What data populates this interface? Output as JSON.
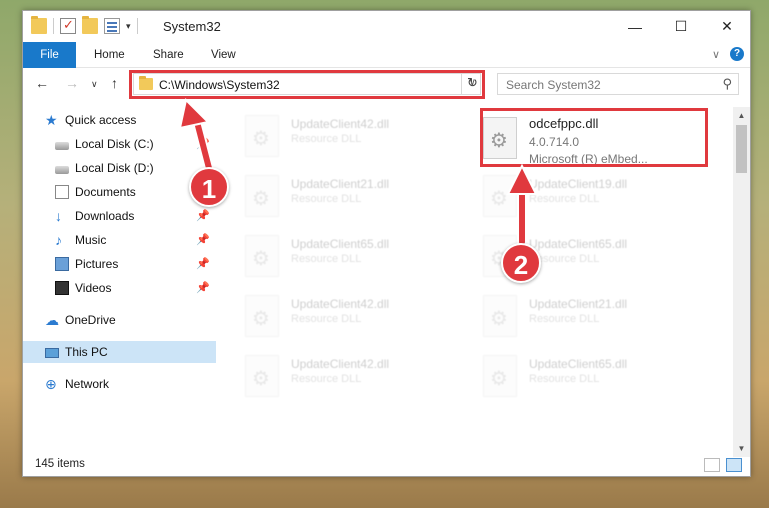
{
  "window": {
    "title": "System32"
  },
  "ribbon": {
    "tabs": [
      "File",
      "Home",
      "Share",
      "View"
    ]
  },
  "address": {
    "path": "C:\\Windows\\System32"
  },
  "search": {
    "placeholder": "Search System32"
  },
  "sidebar": {
    "items": [
      {
        "label": "Quick access",
        "icon": "star-icon",
        "pinned": false
      },
      {
        "label": "Local Disk (C:)",
        "icon": "disk-icon",
        "pinned": true
      },
      {
        "label": "Local Disk (D:)",
        "icon": "disk-icon",
        "pinned": false
      },
      {
        "label": "Documents",
        "icon": "documents-icon",
        "pinned": true
      },
      {
        "label": "Downloads",
        "icon": "downloads-icon",
        "pinned": true
      },
      {
        "label": "Music",
        "icon": "music-icon",
        "pinned": true
      },
      {
        "label": "Pictures",
        "icon": "pictures-icon",
        "pinned": true
      },
      {
        "label": "Videos",
        "icon": "videos-icon",
        "pinned": true
      },
      {
        "label": "OneDrive",
        "icon": "onedrive-icon",
        "pinned": false
      },
      {
        "label": "This PC",
        "icon": "this-pc-icon",
        "pinned": false,
        "selected": true
      },
      {
        "label": "Network",
        "icon": "network-icon",
        "pinned": false
      }
    ]
  },
  "files": {
    "highlighted": {
      "name": "odcefppc.dll",
      "version": "4.0.714.0",
      "description": "Microsoft (R) eMbed..."
    },
    "left_column": [
      {
        "name": "UpdateClient42.dll",
        "type": "Resource DLL"
      },
      {
        "name": "UpdateClient21.dll",
        "type": "Resource DLL"
      },
      {
        "name": "UpdateClient65.dll",
        "type": "Resource DLL"
      },
      {
        "name": "UpdateClient42.dll",
        "type": "Resource DLL"
      },
      {
        "name": "UpdateClient42.dll",
        "type": "Resource DLL"
      }
    ],
    "right_column": [
      {
        "name": "UpdateClient19.dll",
        "type": "Resource DLL"
      },
      {
        "name": "UpdateClient65.dll",
        "type": "Resource DLL"
      },
      {
        "name": "UpdateClient21.dll",
        "type": "Resource DLL"
      },
      {
        "name": "UpdateClient65.dll",
        "type": "Resource DLL"
      }
    ]
  },
  "status": {
    "item_count": "145 items"
  },
  "callouts": [
    "1",
    "2"
  ],
  "colors": {
    "accent": "#1979ca",
    "highlight": "#e0393e",
    "selection": "#cce4f7"
  }
}
